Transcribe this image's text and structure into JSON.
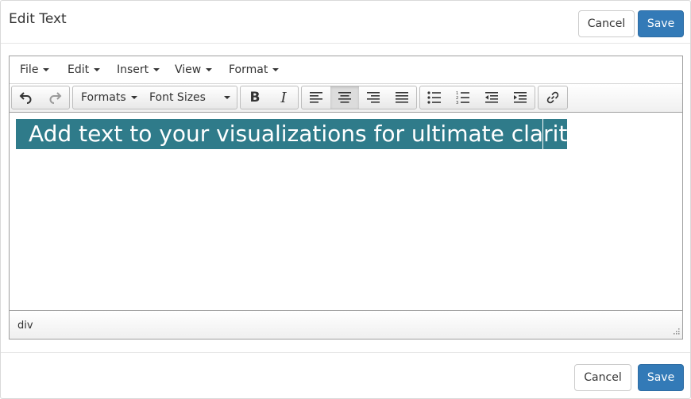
{
  "dialog": {
    "title": "Edit Text",
    "header_buttons": {
      "cancel": "Cancel",
      "save": "Save"
    },
    "footer_buttons": {
      "cancel": "Cancel",
      "save": "Save"
    }
  },
  "menubar": {
    "items": [
      {
        "label": "File"
      },
      {
        "label": "Edit"
      },
      {
        "label": "Insert"
      },
      {
        "label": "View"
      },
      {
        "label": "Format"
      }
    ]
  },
  "toolbar": {
    "formats_label": "Formats",
    "font_sizes_label": "Font Sizes",
    "buttons": [
      "undo-icon",
      "redo-icon",
      "bold-icon",
      "italic-icon",
      "align-left-icon",
      "align-center-icon",
      "align-right-icon",
      "align-justify-icon",
      "bullet-list-icon",
      "numbered-list-icon",
      "outdent-icon",
      "indent-icon",
      "link-icon"
    ],
    "active_button": "align-center-icon"
  },
  "content": {
    "text": "Add text to your visualizations for ultimate clarity",
    "highlight_color": "#2f7b8a"
  },
  "statusbar": {
    "path": "div"
  },
  "colors": {
    "primary": "#337ab7",
    "primary_border": "#2e6da4"
  }
}
